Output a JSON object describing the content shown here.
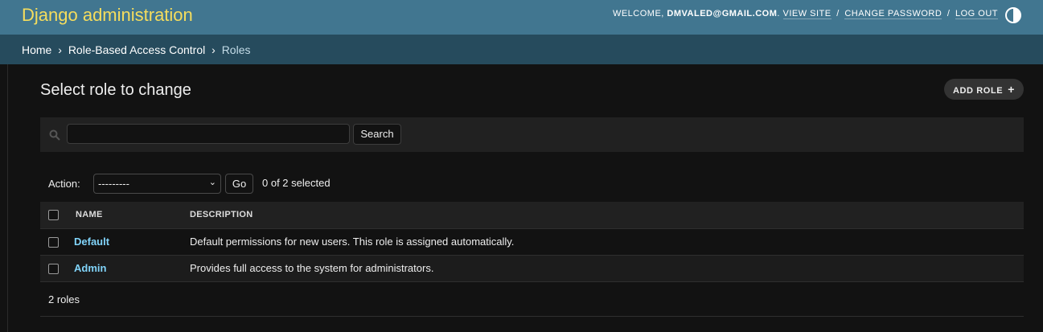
{
  "header": {
    "brand": "Django administration",
    "welcome": "Welcome,",
    "user_email": "dmvaled@gmail.com",
    "view_site": "View site",
    "change_password": "Change password",
    "log_out": "Log out",
    "separator": "/"
  },
  "breadcrumbs": {
    "home": "Home",
    "app": "Role-Based Access Control",
    "current": "Roles",
    "arrow": "›"
  },
  "page": {
    "title": "Select role to change",
    "add_button": "Add role",
    "add_icon": "+"
  },
  "search": {
    "value": "",
    "button": "Search"
  },
  "actions": {
    "label": "Action:",
    "selected_option": "---------",
    "go": "Go",
    "selected_count": "0 of 2 selected"
  },
  "table": {
    "columns": [
      "Name",
      "Description"
    ],
    "rows": [
      {
        "name": "Default",
        "description": "Default permissions for new users. This role is assigned automatically."
      },
      {
        "name": "Admin",
        "description": "Provides full access to the system for administrators."
      }
    ]
  },
  "paginator": "2 roles",
  "colors": {
    "header_bg": "#417690",
    "brand": "#f5dd5d",
    "breadcrumbs_bg": "#264b5d",
    "link": "#81d4fa",
    "background": "#121212"
  }
}
